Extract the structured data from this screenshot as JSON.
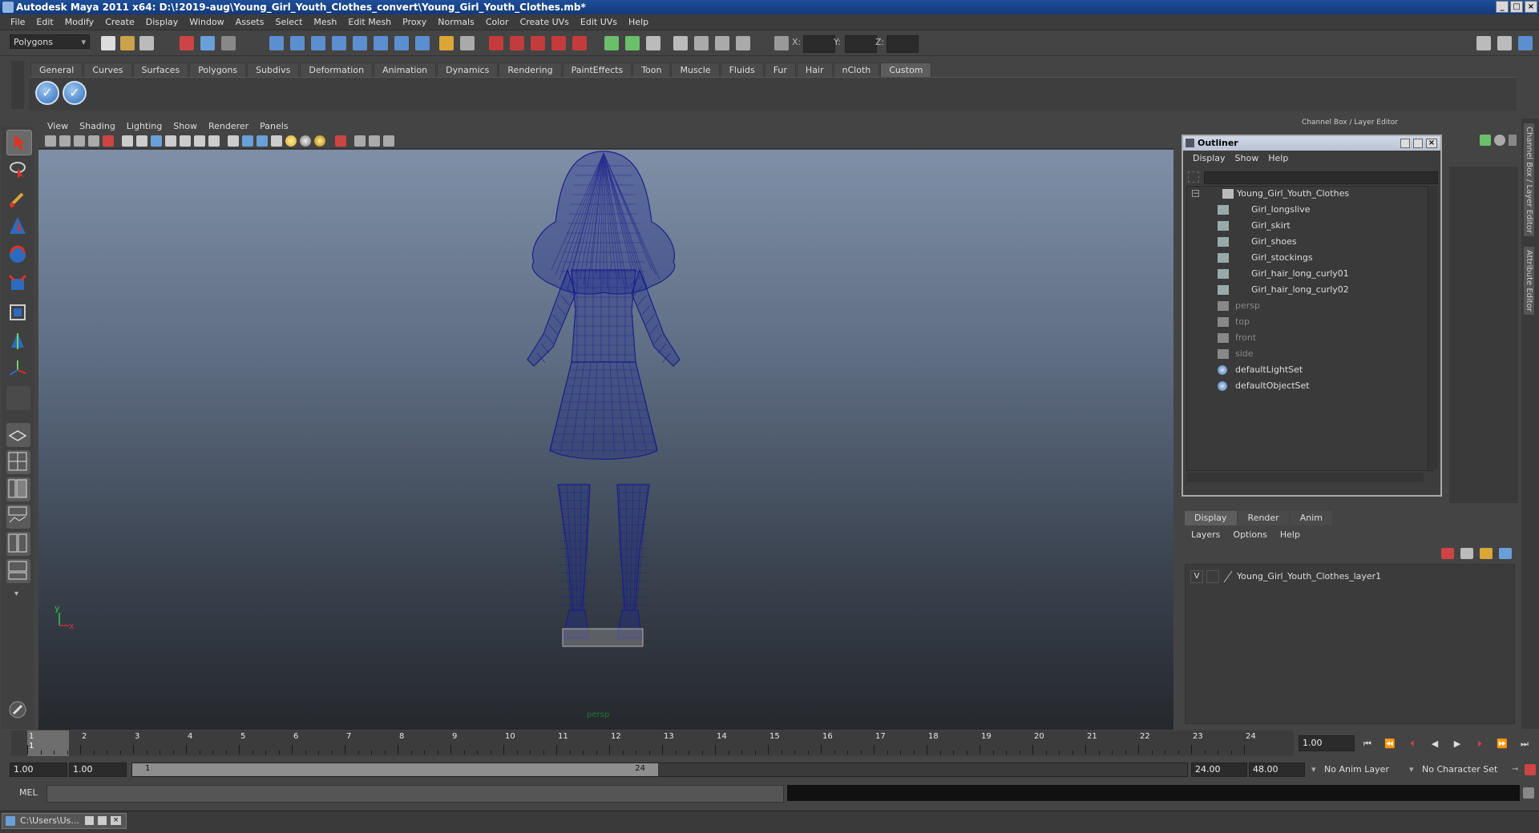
{
  "title": "Autodesk Maya 2011 x64: D:\\!2019-aug\\Young_Girl_Youth_Clothes_convert\\Young_Girl_Youth_Clothes.mb*",
  "window_buttons": [
    "_",
    "□",
    "×"
  ],
  "menubar": [
    "File",
    "Edit",
    "Modify",
    "Create",
    "Display",
    "Window",
    "Assets",
    "Select",
    "Mesh",
    "Edit Mesh",
    "Proxy",
    "Normals",
    "Color",
    "Create UVs",
    "Edit UVs",
    "Help"
  ],
  "status_line": {
    "mode": "Polygons",
    "x_label": "X:",
    "y_label": "Y:",
    "z_label": "Z:"
  },
  "shelf_tabs": [
    "General",
    "Curves",
    "Surfaces",
    "Polygons",
    "Subdivs",
    "Deformation",
    "Animation",
    "Dynamics",
    "Rendering",
    "PaintEffects",
    "Toon",
    "Muscle",
    "Fluids",
    "Fur",
    "Hair",
    "nCloth",
    "Custom"
  ],
  "shelf_active": "Custom",
  "viewport": {
    "menus": [
      "View",
      "Shading",
      "Lighting",
      "Show",
      "Renderer",
      "Panels"
    ],
    "camera_label": "persp",
    "axis_y": "y",
    "axis_x": "x",
    "wire_color": "#1a1f8a"
  },
  "right_panel": {
    "header": "Channel Box / Layer Editor",
    "vertical_tabs": [
      "Channel Box / Layer Editor",
      "Attribute Editor"
    ]
  },
  "outliner": {
    "title": "Outliner",
    "menus": [
      "Display",
      "Show",
      "Help"
    ],
    "root": "Young_Girl_Youth_Clothes",
    "children": [
      "Girl_longslive",
      "Girl_skirt",
      "Girl_shoes",
      "Girl_stockings",
      "Girl_hair_long_curly01",
      "Girl_hair_long_curly02"
    ],
    "cameras": [
      "persp",
      "top",
      "front",
      "side"
    ],
    "sets": [
      "defaultLightSet",
      "defaultObjectSet"
    ]
  },
  "layer_editor": {
    "tabs": [
      "Display",
      "Render",
      "Anim"
    ],
    "active_tab": "Display",
    "menus": [
      "Layers",
      "Options",
      "Help"
    ],
    "layer": {
      "visible": "V",
      "name": "Young_Girl_Youth_Clothes_layer1"
    }
  },
  "time_slider": {
    "ticks": [
      "1",
      "2",
      "3",
      "4",
      "5",
      "6",
      "7",
      "8",
      "9",
      "10",
      "11",
      "12",
      "13",
      "14",
      "15",
      "16",
      "17",
      "18",
      "19",
      "20",
      "21",
      "22",
      "23",
      "24"
    ],
    "current_marker": "1",
    "current_frame": "1.00"
  },
  "range_slider": {
    "start": "1.00",
    "playback_start": "1.00",
    "bar_start": "1",
    "bar_end": "24",
    "playback_end": "24.00",
    "end": "48.00",
    "anim_layer": "No Anim Layer",
    "character_set": "No Character Set"
  },
  "command_line": {
    "label": "MEL"
  },
  "taskbar": {
    "item": "C:\\Users\\Us..."
  }
}
